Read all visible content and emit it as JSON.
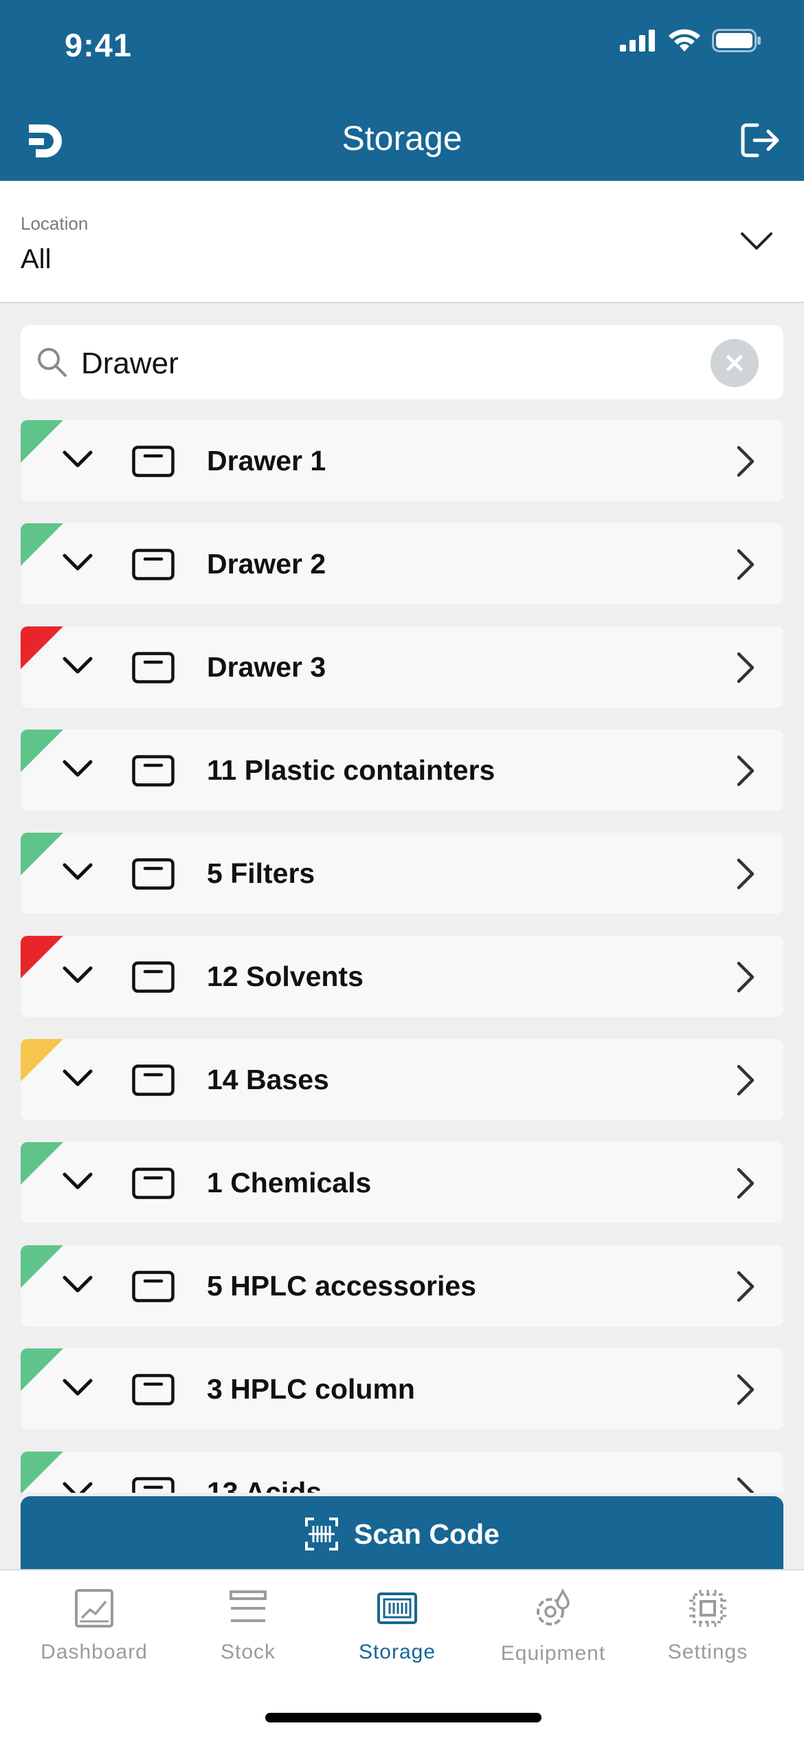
{
  "status_bar": {
    "time": "9:41"
  },
  "header": {
    "title": "Storage"
  },
  "location": {
    "label": "Location",
    "value": "All"
  },
  "search": {
    "value": "Drawer"
  },
  "storage_items": [
    {
      "name": "Drawer 1",
      "status_color": "#5fc48a"
    },
    {
      "name": "Drawer 2",
      "status_color": "#5fc48a"
    },
    {
      "name": "Drawer 3",
      "status_color": "#e8262a"
    },
    {
      "name": "11 Plastic containters",
      "status_color": "#5fc48a"
    },
    {
      "name": "5 Filters",
      "status_color": "#5fc48a"
    },
    {
      "name": "12 Solvents",
      "status_color": "#e8262a"
    },
    {
      "name": "14 Bases",
      "status_color": "#f6c64f"
    },
    {
      "name": "1 Chemicals",
      "status_color": "#5fc48a"
    },
    {
      "name": "5 HPLC accessories",
      "status_color": "#5fc48a"
    },
    {
      "name": "3 HPLC column",
      "status_color": "#5fc48a"
    },
    {
      "name": "13 Acids",
      "status_color": "#5fc48a"
    }
  ],
  "scan_button": {
    "label": "Scan Code"
  },
  "tabs": [
    {
      "label": "Dashboard",
      "icon": "chart-icon"
    },
    {
      "label": "Stock",
      "icon": "list-icon"
    },
    {
      "label": "Storage",
      "icon": "storage-icon",
      "active": true
    },
    {
      "label": "Equipment",
      "icon": "equipment-icon"
    },
    {
      "label": "Settings",
      "icon": "settings-icon"
    }
  ],
  "colors": {
    "primary": "#176694",
    "active_tab": "#176694",
    "inactive_tab": "#9b9b9b"
  }
}
